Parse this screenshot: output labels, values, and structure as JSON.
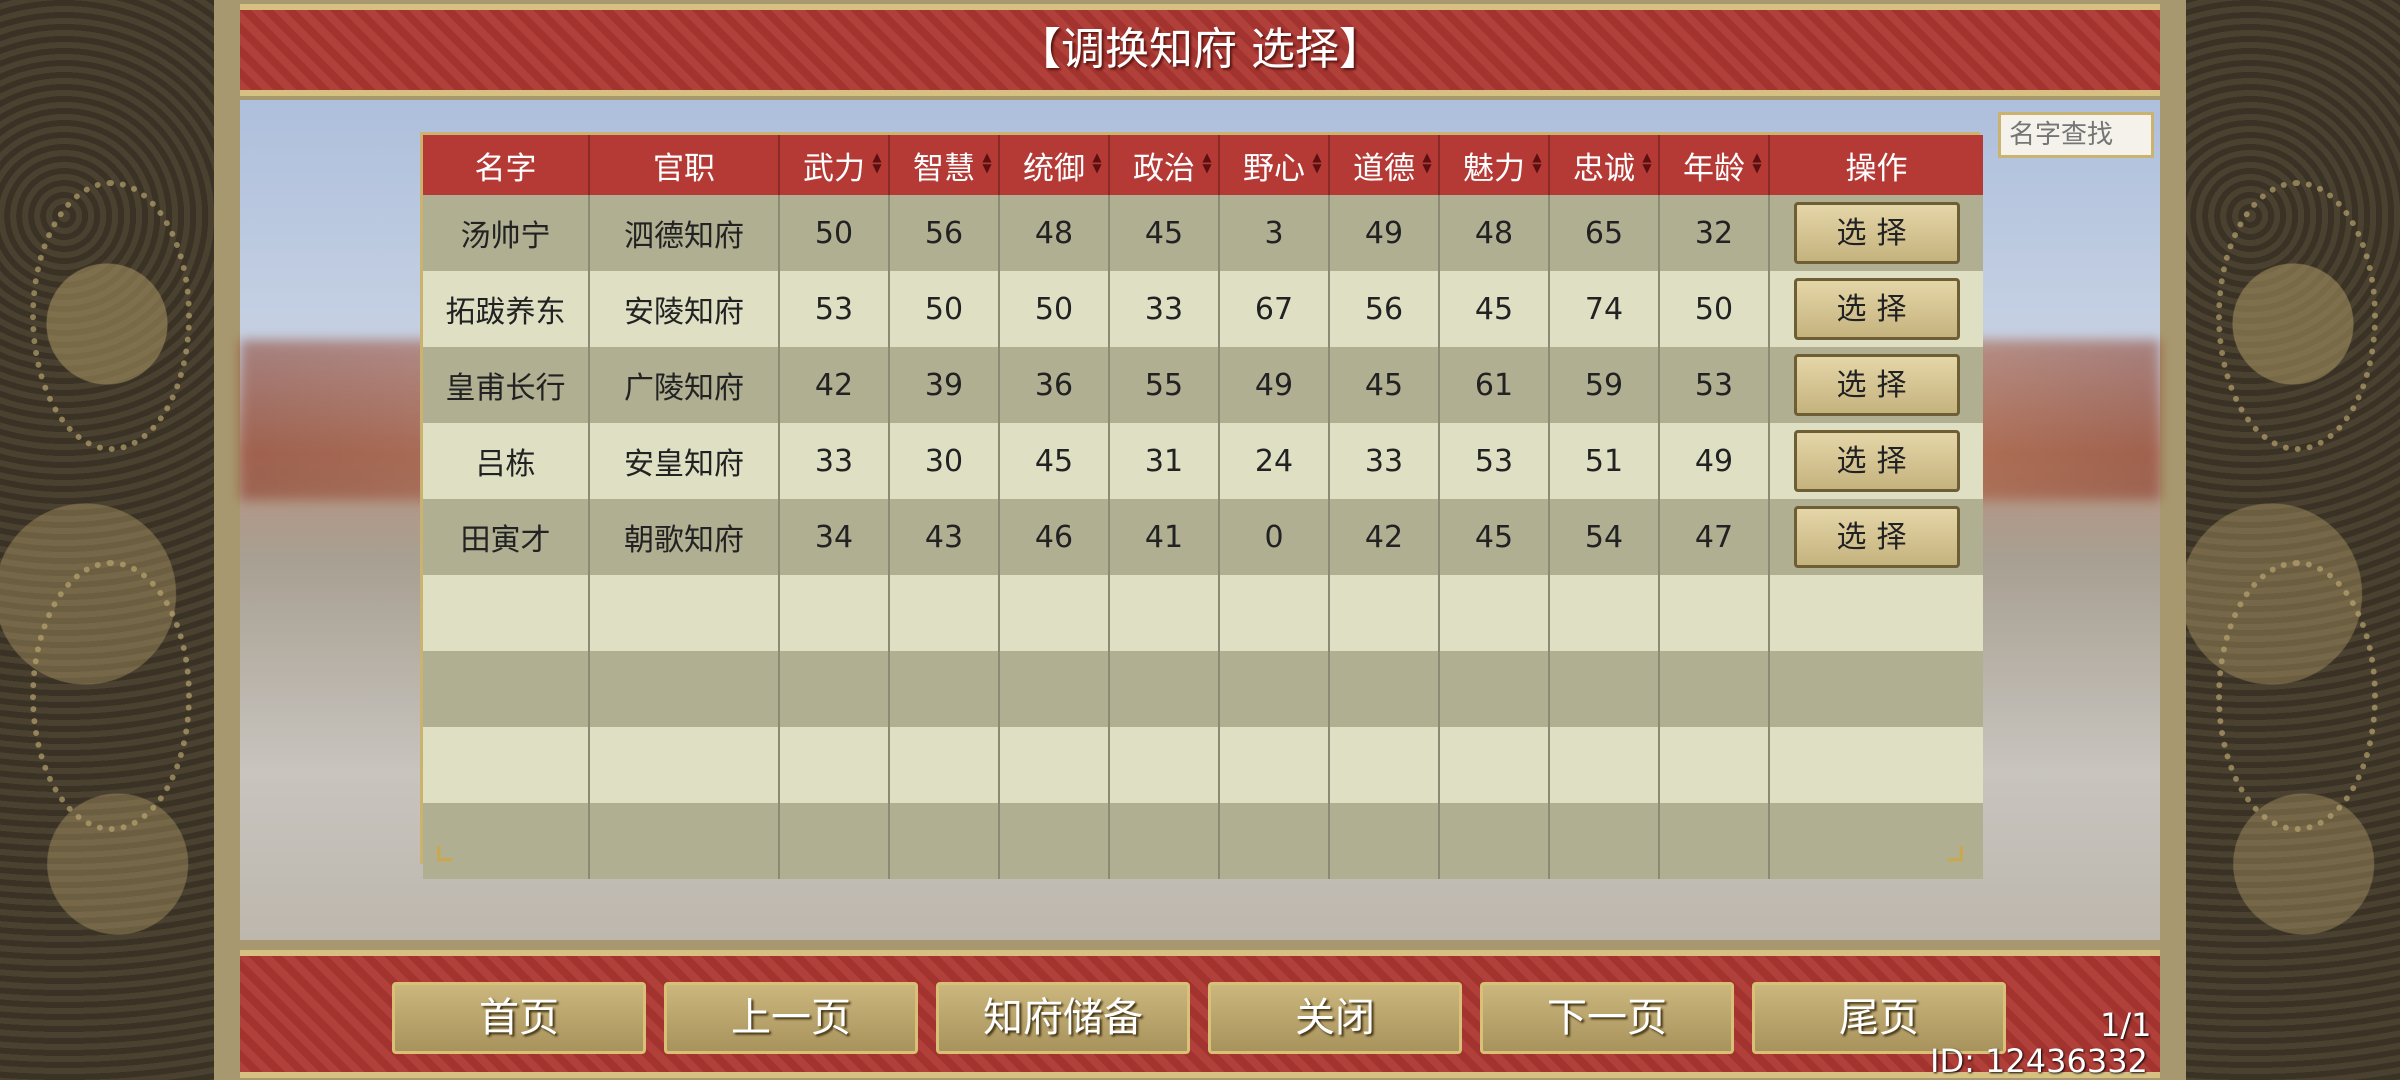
{
  "title": "【调换知府 选择】",
  "search": {
    "placeholder": "名字查找"
  },
  "table": {
    "headers": [
      "名字",
      "官职",
      "武力",
      "智慧",
      "统御",
      "政治",
      "野心",
      "道德",
      "魅力",
      "忠诚",
      "年龄",
      "操作"
    ],
    "rows": [
      {
        "name": "汤帅宁",
        "office": "泗德知府",
        "wuli": "50",
        "zhihui": "56",
        "tongyu": "48",
        "zhengzhi": "45",
        "yexin": "3",
        "daode": "49",
        "meili": "48",
        "zhongcheng": "65",
        "nianling": "32",
        "action": "选择"
      },
      {
        "name": "拓跋养东",
        "office": "安陵知府",
        "wuli": "53",
        "zhihui": "50",
        "tongyu": "50",
        "zhengzhi": "33",
        "yexin": "67",
        "daode": "56",
        "meili": "45",
        "zhongcheng": "74",
        "nianling": "50",
        "action": "选择"
      },
      {
        "name": "皇甫长行",
        "office": "广陵知府",
        "wuli": "42",
        "zhihui": "39",
        "tongyu": "36",
        "zhengzhi": "55",
        "yexin": "49",
        "daode": "45",
        "meili": "61",
        "zhongcheng": "59",
        "nianling": "53",
        "action": "选择"
      },
      {
        "name": "吕栋",
        "office": "安皇知府",
        "wuli": "33",
        "zhihui": "30",
        "tongyu": "45",
        "zhengzhi": "31",
        "yexin": "24",
        "daode": "33",
        "meili": "53",
        "zhongcheng": "51",
        "nianling": "49",
        "action": "选择"
      },
      {
        "name": "田寅才",
        "office": "朝歌知府",
        "wuli": "34",
        "zhihui": "43",
        "tongyu": "46",
        "zhengzhi": "41",
        "yexin": "0",
        "daode": "42",
        "meili": "45",
        "zhongcheng": "54",
        "nianling": "47",
        "action": "选择"
      }
    ]
  },
  "buttons": {
    "first": "首页",
    "prev": "上一页",
    "reserve": "知府储备",
    "close": "关闭",
    "next": "下一页",
    "last": "尾页"
  },
  "page_indicator": "1/1",
  "user_id": "ID: 12436332",
  "colors": {
    "header_red": "#b53a36",
    "banner_red": "#a2332e",
    "gold": "#c9b36e"
  }
}
